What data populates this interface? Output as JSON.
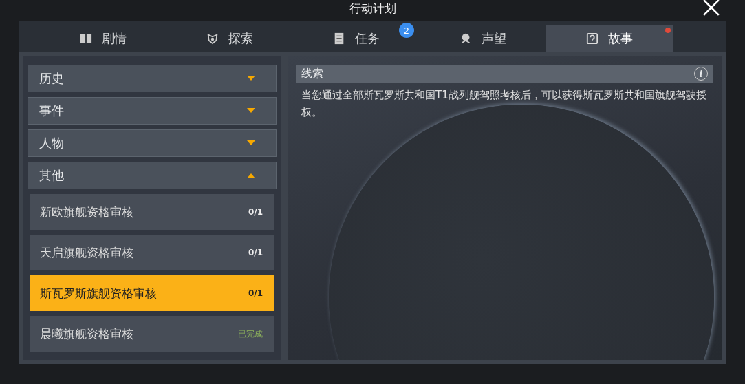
{
  "window": {
    "title": "行动计划"
  },
  "tabs": [
    {
      "label": "剧情",
      "selected": false,
      "dot": false
    },
    {
      "label": "探索",
      "selected": false,
      "dot": false
    },
    {
      "label": "任务",
      "selected": false,
      "badge": "2",
      "dot": false
    },
    {
      "label": "声望",
      "selected": false,
      "dot": false
    },
    {
      "label": "故事",
      "selected": true,
      "dot": true
    }
  ],
  "categories": [
    {
      "label": "历史",
      "expanded": false
    },
    {
      "label": "事件",
      "expanded": false
    },
    {
      "label": "人物",
      "expanded": false
    },
    {
      "label": "其他",
      "expanded": true,
      "items": [
        {
          "label": "新欧旗舰资格审核",
          "status": "0/1",
          "completed": false,
          "selected": false
        },
        {
          "label": "天启旗舰资格审核",
          "status": "0/1",
          "completed": false,
          "selected": false
        },
        {
          "label": "斯瓦罗斯旗舰资格审核",
          "status": "0/1",
          "completed": false,
          "selected": true
        },
        {
          "label": "晨曦旗舰资格审核",
          "status": "已完成",
          "completed": true,
          "selected": false
        }
      ]
    }
  ],
  "detail": {
    "heading": "线索",
    "info_glyph": "i",
    "text": "当您通过全部斯瓦罗斯共和国T1战列舰驾照考核后，可以获得斯瓦罗斯共和国旗舰驾驶授权。"
  }
}
